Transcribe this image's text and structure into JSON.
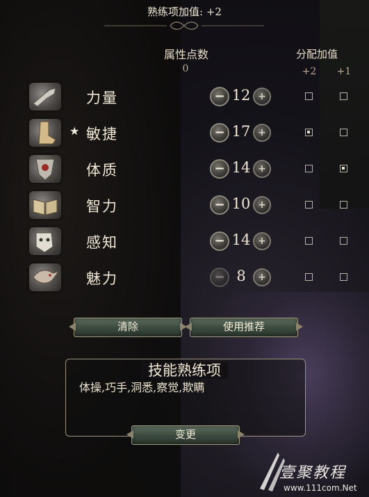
{
  "header": {
    "title": "熟练项加值: +2"
  },
  "columns": {
    "points_label": "属性点数",
    "points_value": "0",
    "bonus_label": "分配加值",
    "bonus_plus2": "+2",
    "bonus_plus1": "+1"
  },
  "attributes": [
    {
      "name": "力量",
      "value": "12",
      "starred": false,
      "plus2": false,
      "plus1": false,
      "icon": "gauntlet-icon"
    },
    {
      "name": "敏捷",
      "value": "17",
      "starred": true,
      "star": "★",
      "plus2": true,
      "plus1": false,
      "icon": "boot-icon"
    },
    {
      "name": "体质",
      "value": "14",
      "starred": false,
      "plus2": false,
      "plus1": true,
      "icon": "heart-shield-icon"
    },
    {
      "name": "智力",
      "value": "10",
      "starred": false,
      "plus2": false,
      "plus1": false,
      "icon": "book-icon"
    },
    {
      "name": "感知",
      "value": "14",
      "starred": false,
      "plus2": false,
      "plus1": false,
      "icon": "mask-icon"
    },
    {
      "name": "魅力",
      "value": "8",
      "starred": false,
      "plus2": false,
      "plus1": false,
      "icon": "bird-icon"
    }
  ],
  "buttons": {
    "minus": "−",
    "plus": "+",
    "clear": "清除",
    "recommend": "使用推荐",
    "change": "变更"
  },
  "skills": {
    "title": "技能熟练项",
    "list": "体操,巧手,洞悉,察觉,欺瞒"
  },
  "watermark": {
    "name": "壹聚教程",
    "url": "www.111com.Net"
  },
  "colors": {
    "text": "#f0e9d7",
    "button_green": "#3d4b40",
    "border": "#9d9685"
  }
}
